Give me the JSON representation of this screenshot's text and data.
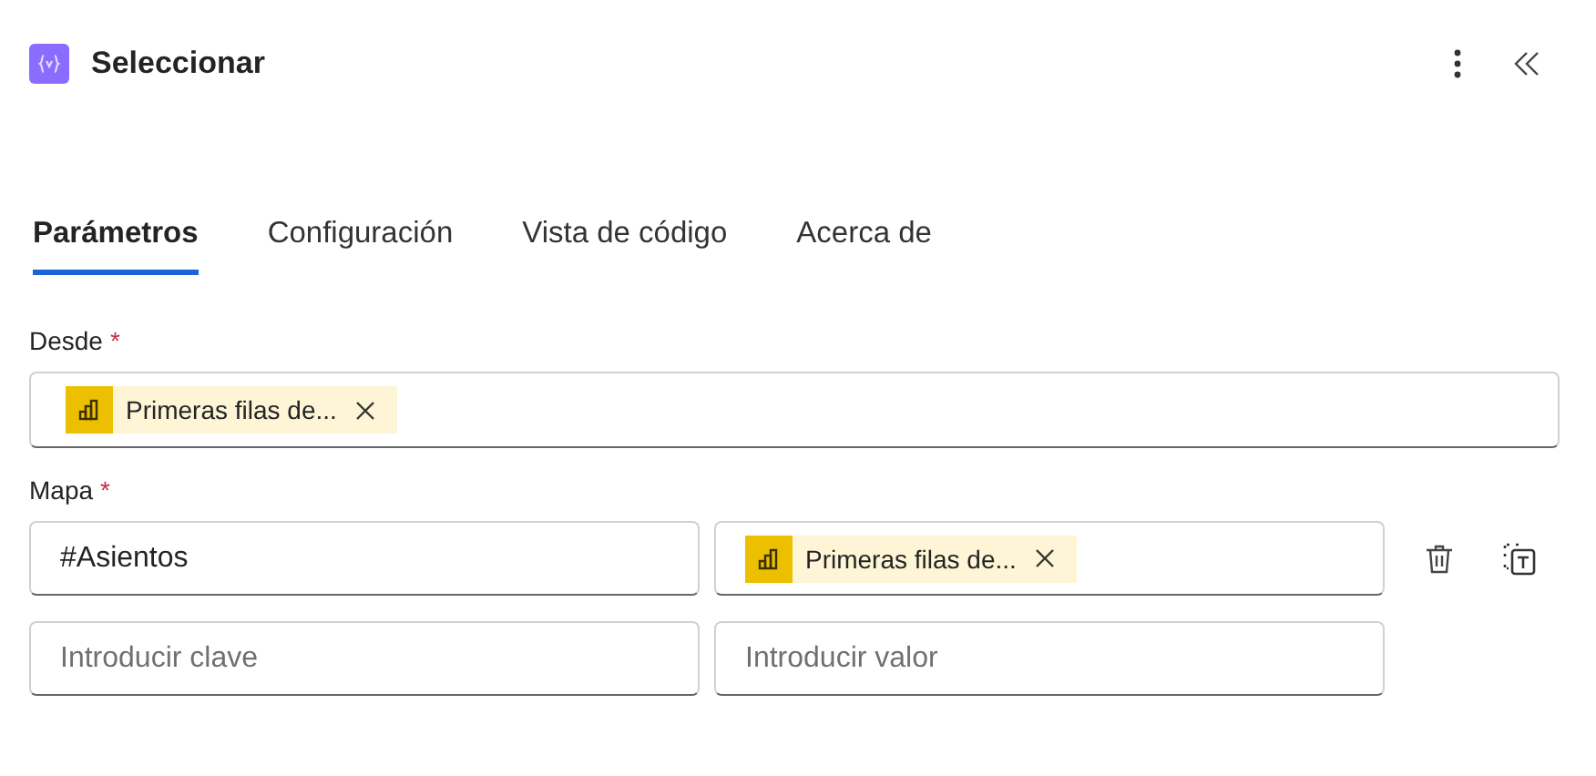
{
  "header": {
    "title": "Seleccionar"
  },
  "tabs": [
    {
      "label": "Parámetros",
      "selected": true
    },
    {
      "label": "Configuración",
      "selected": false
    },
    {
      "label": "Vista de código",
      "selected": false
    },
    {
      "label": "Acerca de",
      "selected": false
    }
  ],
  "from": {
    "label": "Desde",
    "required_mark": "*",
    "tokens": [
      {
        "text": "Primeras filas de..."
      }
    ]
  },
  "map": {
    "label": "Mapa",
    "required_mark": "*",
    "rows": [
      {
        "key": {
          "value": "#Asientos"
        },
        "value": {
          "tokens": [
            {
              "text": "Primeras filas de..."
            }
          ]
        },
        "actions": true
      },
      {
        "key": {
          "placeholder": "Introducir clave"
        },
        "value": {
          "placeholder": "Introducir valor"
        },
        "actions": false
      }
    ]
  }
}
